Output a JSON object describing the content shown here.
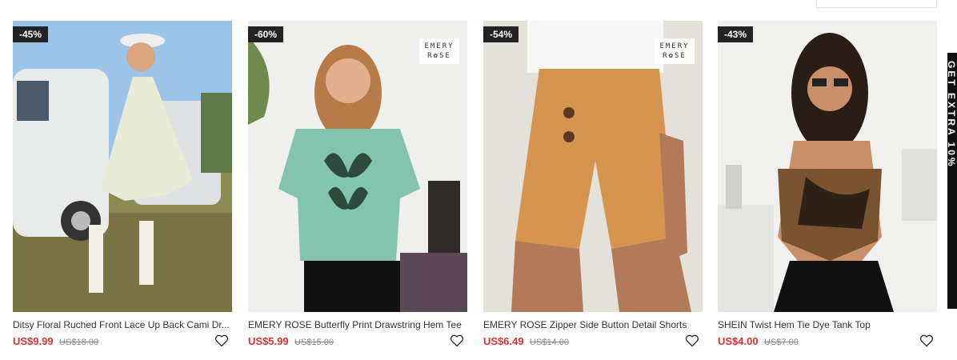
{
  "side_tab": {
    "label": "GET EXTRA 10%"
  },
  "products": [
    {
      "discount": "-45%",
      "title": "Ditsy Floral Ruched Front Lace Up Back Cami Dr...",
      "price": "US$9.99",
      "original_price": "US$18.00",
      "brand_logo": null
    },
    {
      "discount": "-60%",
      "title": "EMERY ROSE Butterfly Print Drawstring Hem Tee",
      "price": "US$5.99",
      "original_price": "US$15.00",
      "brand_logo": {
        "line1": "EMERY",
        "line2": "ROSE"
      }
    },
    {
      "discount": "-54%",
      "title": "EMERY ROSE Zipper Side Button Detail Shorts",
      "price": "US$6.49",
      "original_price": "US$14.00",
      "brand_logo": {
        "line1": "EMERY",
        "line2": "ROSE"
      }
    },
    {
      "discount": "-43%",
      "title": "SHEIN Twist Hem Tie Dye Tank Top",
      "price": "US$4.00",
      "original_price": "US$7.00",
      "brand_logo": null
    }
  ],
  "colors": {
    "price": "#d53333",
    "badge_bg": "#222222"
  }
}
